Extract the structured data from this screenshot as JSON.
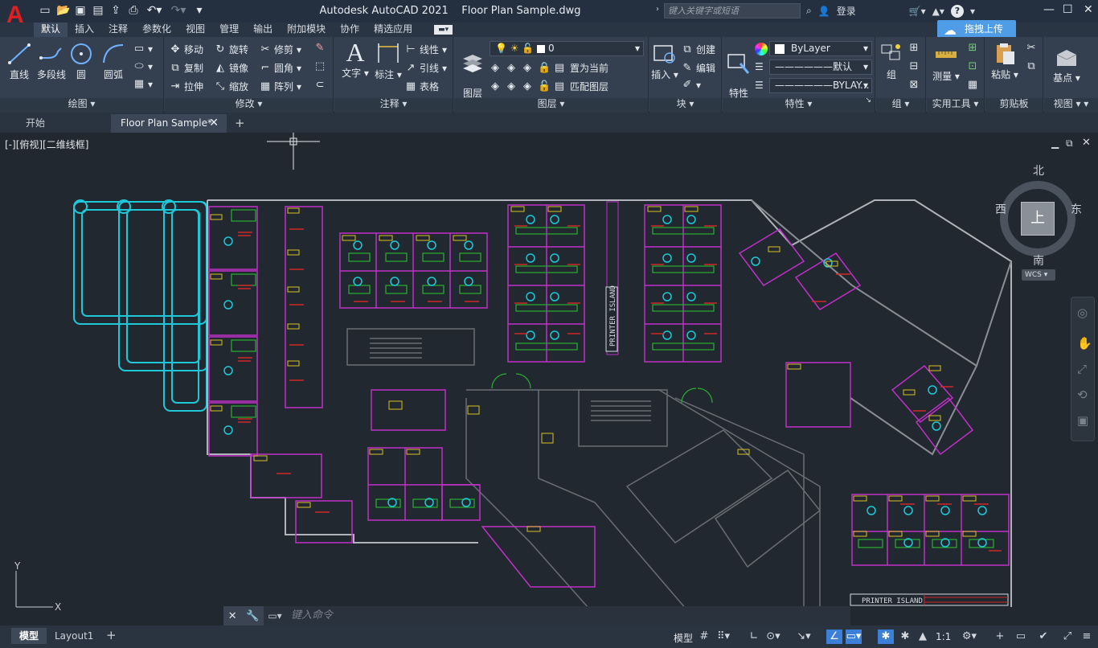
{
  "titlebar": {
    "app_name": "Autodesk AutoCAD 2021",
    "file_name": "Floor Plan Sample.dwg",
    "search_placeholder": "键入关键字或短语",
    "login": "登录"
  },
  "ribbon_tabs": [
    "默认",
    "插入",
    "注释",
    "参数化",
    "视图",
    "管理",
    "输出",
    "附加模块",
    "协作",
    "精选应用"
  ],
  "upload_button": "拖拽上传",
  "draw_panel": {
    "label": "绘图",
    "line": "直线",
    "polyline": "多段线",
    "circle": "圆",
    "arc": "圆弧"
  },
  "modify_panel": {
    "label": "修改",
    "move": "移动",
    "rotate": "旋转",
    "trim": "修剪",
    "copy": "复制",
    "mirror": "镜像",
    "fillet": "圆角",
    "stretch": "拉伸",
    "scale": "缩放",
    "array": "阵列"
  },
  "annotation_panel": {
    "label": "注释",
    "text": "文字",
    "dimension": "标注",
    "linear": "线性",
    "leader": "引线",
    "table": "表格"
  },
  "layers_panel": {
    "label": "图层",
    "layer_properties": "图层\n特性",
    "current_layer": "0",
    "set_current": "置为当前",
    "match_layer": "匹配图层"
  },
  "block_panel": {
    "label": "块",
    "insert": "插入",
    "create": "创建",
    "edit": "编辑"
  },
  "properties_panel": {
    "label": "特性",
    "match": "特性\n匹配",
    "color": "ByLayer",
    "linetype": "默认",
    "lineweight": "BYLAY..."
  },
  "groups_panel": {
    "label": "组",
    "group": "组"
  },
  "utilities_panel": {
    "label": "实用工具",
    "measure": "测量"
  },
  "clipboard_panel": {
    "label": "剪贴板",
    "paste": "粘贴"
  },
  "view_panel": {
    "label": "视图",
    "base": "基点"
  },
  "file_tabs": [
    {
      "label": "开始"
    },
    {
      "label": "Floor Plan Sample*"
    }
  ],
  "viewport": {
    "label": "[-][俯视][二维线框]",
    "viewcube": {
      "north": "北",
      "south": "南",
      "east": "东",
      "west": "西",
      "top": "上",
      "wcs": "WCS"
    },
    "printer_island_1": "PRINTER ISLAND",
    "printer_island_2": "PRINTER ISLAND",
    "axis_y": "Y",
    "axis_x": "X"
  },
  "command_line": {
    "placeholder": "键入命令"
  },
  "layout_tabs": [
    "模型",
    "Layout1"
  ],
  "status": {
    "model": "模型",
    "scale": "1:1"
  },
  "colors": {
    "accent": "#4f9de6",
    "titlebar": "#243040",
    "ribbon": "#34404f",
    "viewport": "#212830",
    "cyan": "#1ec8d8",
    "magenta": "#c030c8",
    "green": "#28b030",
    "yellow": "#d8c020"
  }
}
